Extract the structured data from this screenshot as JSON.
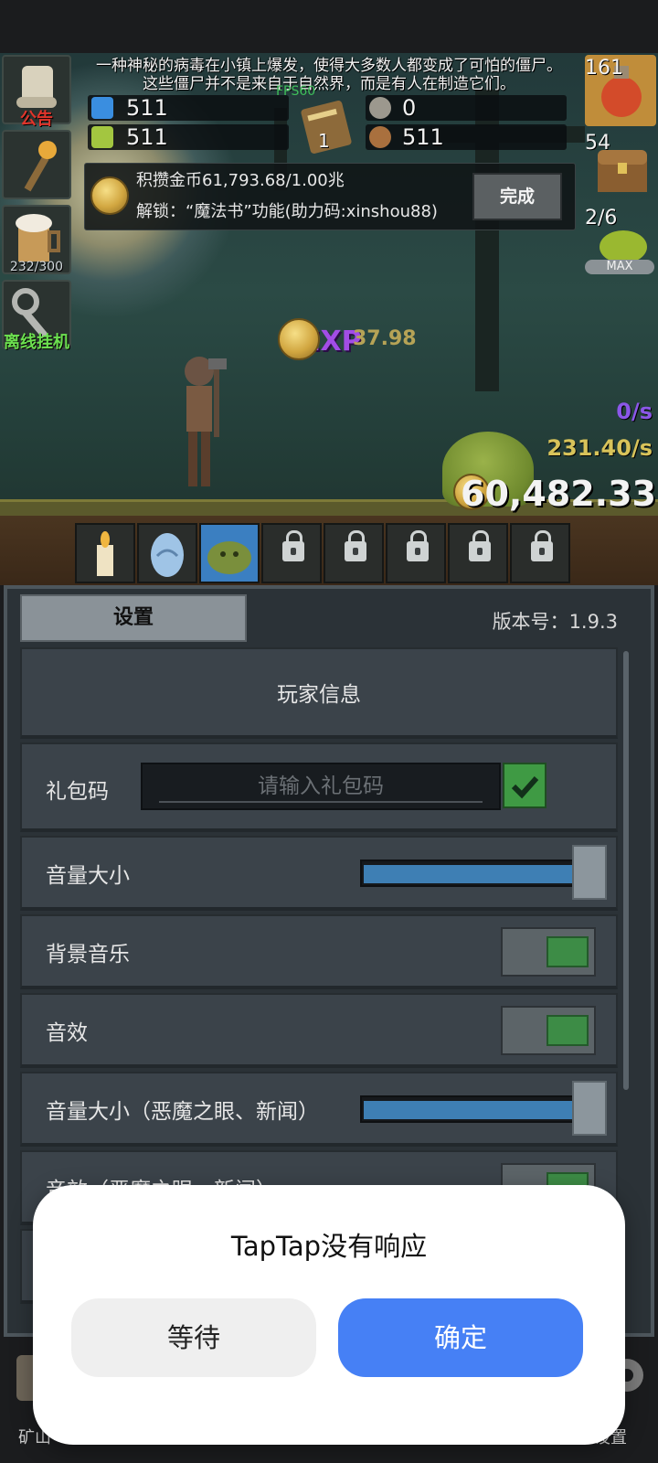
{
  "notice": {
    "line1": "一种神秘的病毒在小镇上爆发，使得大多数人都变成了可怕的僵尸。",
    "line2": "这些僵尸并不是来自于自然界，而是有人在制造它们。",
    "fps": "FPS60"
  },
  "sidebar": {
    "announcement_label": "公告",
    "beer_counter": "232/300",
    "offline_label": "离线挂机"
  },
  "resources": {
    "blue_potion": "511",
    "green_potion": "511",
    "silver_ore": "0",
    "bronze_ore": "511",
    "book_count": "1"
  },
  "task": {
    "progress_text": "积攒金币61,793.68/1.00兆",
    "unlock_text": "解锁：“魔法书”功能(助力码:xinshou88)",
    "done_label": "完成"
  },
  "right_panel": {
    "potion_count": "161",
    "chest_count": "54",
    "slime_count": "2/6",
    "slime_badge": "MAX"
  },
  "battle": {
    "exp_label": "EXP",
    "exp_value": "37.98",
    "rate_purple": "0/s",
    "rate_gold": "231.40/s",
    "gold_total": "60,482.33"
  },
  "skill_slots": [
    {
      "name": "candle",
      "locked": false
    },
    {
      "name": "egg",
      "locked": false
    },
    {
      "name": "slime",
      "locked": false,
      "active": true
    },
    {
      "name": "locked-1",
      "locked": true
    },
    {
      "name": "locked-2",
      "locked": true
    },
    {
      "name": "locked-3",
      "locked": true
    },
    {
      "name": "locked-4",
      "locked": true
    },
    {
      "name": "locked-5",
      "locked": true
    }
  ],
  "settings": {
    "tab_label": "设置",
    "version_label": "版本号：",
    "version_value": "1.9.3",
    "player_info": "玩家信息",
    "gift_code_label": "礼包码",
    "gift_code_placeholder": "请输入礼包码",
    "volume_label": "音量大小",
    "volume_level": 1.0,
    "bgm_label": "背景音乐",
    "bgm_on": true,
    "sfx_label": "音效",
    "sfx_on": true,
    "volume2_label": "音量大小（恶魔之眼、新闻）",
    "volume2_level": 1.0,
    "sfx2_label": "音效（恶魔之眼、新闻）"
  },
  "bottom_nav": {
    "mine_label": "矿山",
    "settings_label": "设置"
  },
  "dialog": {
    "title": "TapTap没有响应",
    "wait_label": "等待",
    "ok_label": "确定"
  },
  "colors": {
    "dialog_ok": "#4680f5",
    "slider_fill": "#3e7fb4",
    "toggle_on": "#3d8c46",
    "exp_purple": "#a24de6"
  }
}
